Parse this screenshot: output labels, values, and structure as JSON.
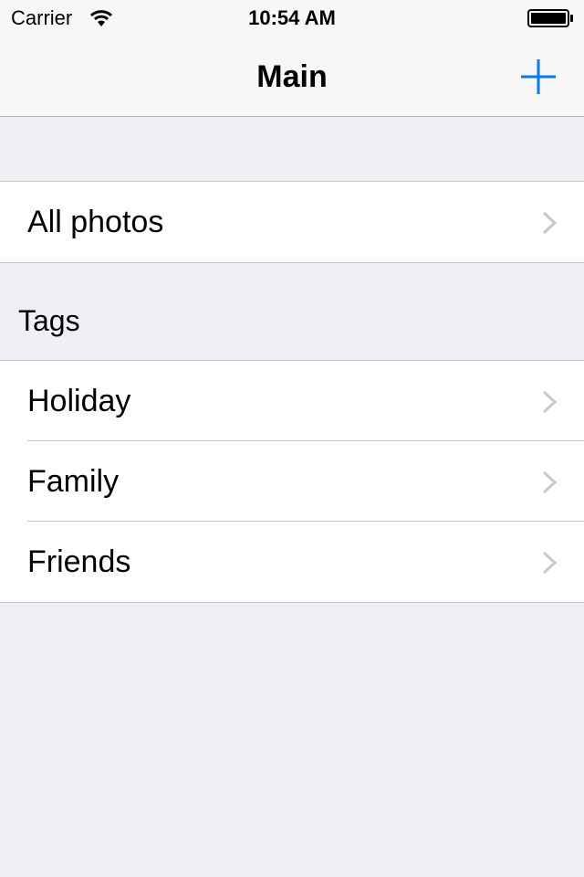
{
  "status_bar": {
    "carrier": "Carrier",
    "time": "10:54 AM",
    "wifi_icon": "wifi-icon",
    "battery_icon": "battery-icon"
  },
  "nav": {
    "title": "Main",
    "add_icon": "plus-icon",
    "accent_color": "#007aff"
  },
  "all_photos": {
    "label": "All photos"
  },
  "tags_section": {
    "header": "Tags",
    "items": [
      {
        "label": "Holiday"
      },
      {
        "label": "Family"
      },
      {
        "label": "Friends"
      }
    ]
  }
}
